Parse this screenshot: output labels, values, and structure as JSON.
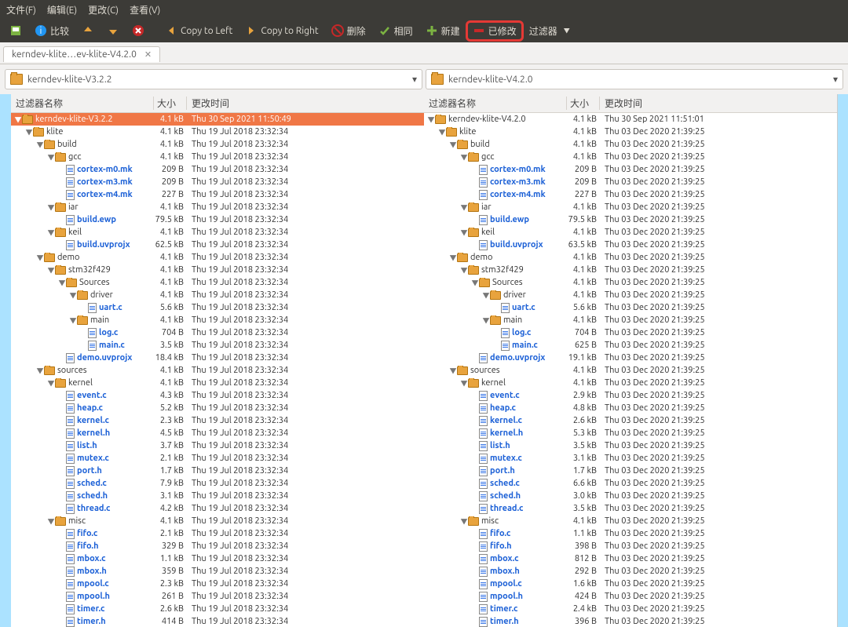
{
  "menu": {
    "file": "文件(F)",
    "edit": "编辑(E)",
    "changes": "更改(C)",
    "view": "查看(V)"
  },
  "toolbar": {
    "compare": "比较",
    "copy_left": "Copy to Left",
    "copy_right": "Copy to Right",
    "delete": "删除",
    "same": "相同",
    "new": "新建",
    "modified": "已修改",
    "filters": "过滤器"
  },
  "tab_title": "kerndev-klite…ev-klite-V4.2.0",
  "combo_left": "kerndev-klite-V3.2.2",
  "combo_right": "kerndev-klite-V4.2.0",
  "hdr": {
    "name": "过滤器名称",
    "size": "大小",
    "date": "更改时间"
  },
  "left": [
    {
      "d": 0,
      "t": "dir",
      "tw": "▼",
      "sel": true,
      "n": "kerndev-klite-V3.2.2",
      "s": "4.1 kB",
      "dt": "Thu 30 Sep 2021 11:50:49"
    },
    {
      "d": 1,
      "t": "dir",
      "tw": "▼",
      "n": "klite",
      "s": "4.1 kB",
      "dt": "Thu 19 Jul 2018 23:32:34"
    },
    {
      "d": 2,
      "t": "dir",
      "tw": "▼",
      "n": "build",
      "s": "4.1 kB",
      "dt": "Thu 19 Jul 2018 23:32:34"
    },
    {
      "d": 3,
      "t": "dir",
      "tw": "▼",
      "n": "gcc",
      "s": "4.1 kB",
      "dt": "Thu 19 Jul 2018 23:32:34"
    },
    {
      "d": 4,
      "t": "mod",
      "n": "cortex-m0.mk",
      "s": "209 B",
      "dt": "Thu 19 Jul 2018 23:32:34"
    },
    {
      "d": 4,
      "t": "mod",
      "n": "cortex-m3.mk",
      "s": "209 B",
      "dt": "Thu 19 Jul 2018 23:32:34"
    },
    {
      "d": 4,
      "t": "mod",
      "n": "cortex-m4.mk",
      "s": "227 B",
      "dt": "Thu 19 Jul 2018 23:32:34"
    },
    {
      "d": 3,
      "t": "dir",
      "tw": "▼",
      "n": "iar",
      "s": "4.1 kB",
      "dt": "Thu 19 Jul 2018 23:32:34"
    },
    {
      "d": 4,
      "t": "mod",
      "n": "build.ewp",
      "s": "79.5 kB",
      "dt": "Thu 19 Jul 2018 23:32:34"
    },
    {
      "d": 3,
      "t": "dir",
      "tw": "▼",
      "n": "keil",
      "s": "4.1 kB",
      "dt": "Thu 19 Jul 2018 23:32:34"
    },
    {
      "d": 4,
      "t": "mod",
      "n": "build.uvprojx",
      "s": "62.5 kB",
      "dt": "Thu 19 Jul 2018 23:32:34"
    },
    {
      "d": 2,
      "t": "dir",
      "tw": "▼",
      "n": "demo",
      "s": "4.1 kB",
      "dt": "Thu 19 Jul 2018 23:32:34"
    },
    {
      "d": 3,
      "t": "dir",
      "tw": "▼",
      "n": "stm32f429",
      "s": "4.1 kB",
      "dt": "Thu 19 Jul 2018 23:32:34"
    },
    {
      "d": 4,
      "t": "dir",
      "tw": "▼",
      "n": "Sources",
      "s": "4.1 kB",
      "dt": "Thu 19 Jul 2018 23:32:34"
    },
    {
      "d": 5,
      "t": "dir",
      "tw": "▼",
      "n": "driver",
      "s": "4.1 kB",
      "dt": "Thu 19 Jul 2018 23:32:34"
    },
    {
      "d": 6,
      "t": "mod",
      "n": "uart.c",
      "s": "5.6 kB",
      "dt": "Thu 19 Jul 2018 23:32:34"
    },
    {
      "d": 5,
      "t": "dir",
      "tw": "▼",
      "n": "main",
      "s": "4.1 kB",
      "dt": "Thu 19 Jul 2018 23:32:34"
    },
    {
      "d": 6,
      "t": "mod",
      "n": "log.c",
      "s": "704 B",
      "dt": "Thu 19 Jul 2018 23:32:34"
    },
    {
      "d": 6,
      "t": "mod",
      "n": "main.c",
      "s": "3.5 kB",
      "dt": "Thu 19 Jul 2018 23:32:34"
    },
    {
      "d": 4,
      "t": "mod",
      "n": "demo.uvprojx",
      "s": "18.4 kB",
      "dt": "Thu 19 Jul 2018 23:32:34"
    },
    {
      "d": 2,
      "t": "dir",
      "tw": "▼",
      "n": "sources",
      "s": "4.1 kB",
      "dt": "Thu 19 Jul 2018 23:32:34"
    },
    {
      "d": 3,
      "t": "dir",
      "tw": "▼",
      "n": "kernel",
      "s": "4.1 kB",
      "dt": "Thu 19 Jul 2018 23:32:34"
    },
    {
      "d": 4,
      "t": "mod",
      "n": "event.c",
      "s": "4.3 kB",
      "dt": "Thu 19 Jul 2018 23:32:34"
    },
    {
      "d": 4,
      "t": "mod",
      "n": "heap.c",
      "s": "5.2 kB",
      "dt": "Thu 19 Jul 2018 23:32:34"
    },
    {
      "d": 4,
      "t": "mod",
      "n": "kernel.c",
      "s": "2.3 kB",
      "dt": "Thu 19 Jul 2018 23:32:34"
    },
    {
      "d": 4,
      "t": "mod",
      "n": "kernel.h",
      "s": "4.5 kB",
      "dt": "Thu 19 Jul 2018 23:32:34"
    },
    {
      "d": 4,
      "t": "mod",
      "n": "list.h",
      "s": "3.7 kB",
      "dt": "Thu 19 Jul 2018 23:32:34"
    },
    {
      "d": 4,
      "t": "mod",
      "n": "mutex.c",
      "s": "2.1 kB",
      "dt": "Thu 19 Jul 2018 23:32:34"
    },
    {
      "d": 4,
      "t": "mod",
      "n": "port.h",
      "s": "1.7 kB",
      "dt": "Thu 19 Jul 2018 23:32:34"
    },
    {
      "d": 4,
      "t": "mod",
      "n": "sched.c",
      "s": "7.9 kB",
      "dt": "Thu 19 Jul 2018 23:32:34"
    },
    {
      "d": 4,
      "t": "mod",
      "n": "sched.h",
      "s": "3.1 kB",
      "dt": "Thu 19 Jul 2018 23:32:34"
    },
    {
      "d": 4,
      "t": "mod",
      "n": "thread.c",
      "s": "4.2 kB",
      "dt": "Thu 19 Jul 2018 23:32:34"
    },
    {
      "d": 3,
      "t": "dir",
      "tw": "▼",
      "n": "misc",
      "s": "4.1 kB",
      "dt": "Thu 19 Jul 2018 23:32:34"
    },
    {
      "d": 4,
      "t": "mod",
      "n": "fifo.c",
      "s": "2.1 kB",
      "dt": "Thu 19 Jul 2018 23:32:34"
    },
    {
      "d": 4,
      "t": "mod",
      "n": "fifo.h",
      "s": "329 B",
      "dt": "Thu 19 Jul 2018 23:32:34"
    },
    {
      "d": 4,
      "t": "mod",
      "n": "mbox.c",
      "s": "1.1 kB",
      "dt": "Thu 19 Jul 2018 23:32:34"
    },
    {
      "d": 4,
      "t": "mod",
      "n": "mbox.h",
      "s": "359 B",
      "dt": "Thu 19 Jul 2018 23:32:34"
    },
    {
      "d": 4,
      "t": "mod",
      "n": "mpool.c",
      "s": "2.3 kB",
      "dt": "Thu 19 Jul 2018 23:32:34"
    },
    {
      "d": 4,
      "t": "mod",
      "n": "mpool.h",
      "s": "261 B",
      "dt": "Thu 19 Jul 2018 23:32:34"
    },
    {
      "d": 4,
      "t": "mod",
      "n": "timer.c",
      "s": "2.6 kB",
      "dt": "Thu 19 Jul 2018 23:32:34"
    },
    {
      "d": 4,
      "t": "mod",
      "n": "timer.h",
      "s": "414 B",
      "dt": "Thu 19 Jul 2018 23:32:34"
    }
  ],
  "right": [
    {
      "d": 0,
      "t": "dir",
      "tw": "▼",
      "n": "kerndev-klite-V4.2.0",
      "s": "4.1 kB",
      "dt": "Thu 30 Sep 2021 11:51:01"
    },
    {
      "d": 1,
      "t": "dir",
      "tw": "▼",
      "n": "klite",
      "s": "4.1 kB",
      "dt": "Thu 03 Dec 2020 21:39:25"
    },
    {
      "d": 2,
      "t": "dir",
      "tw": "▼",
      "n": "build",
      "s": "4.1 kB",
      "dt": "Thu 03 Dec 2020 21:39:25"
    },
    {
      "d": 3,
      "t": "dir",
      "tw": "▼",
      "n": "gcc",
      "s": "4.1 kB",
      "dt": "Thu 03 Dec 2020 21:39:25"
    },
    {
      "d": 4,
      "t": "mod",
      "n": "cortex-m0.mk",
      "s": "209 B",
      "dt": "Thu 03 Dec 2020 21:39:25"
    },
    {
      "d": 4,
      "t": "mod",
      "n": "cortex-m3.mk",
      "s": "209 B",
      "dt": "Thu 03 Dec 2020 21:39:25"
    },
    {
      "d": 4,
      "t": "mod",
      "n": "cortex-m4.mk",
      "s": "227 B",
      "dt": "Thu 03 Dec 2020 21:39:25"
    },
    {
      "d": 3,
      "t": "dir",
      "tw": "▼",
      "n": "iar",
      "s": "4.1 kB",
      "dt": "Thu 03 Dec 2020 21:39:25"
    },
    {
      "d": 4,
      "t": "mod",
      "n": "build.ewp",
      "s": "79.5 kB",
      "dt": "Thu 03 Dec 2020 21:39:25"
    },
    {
      "d": 3,
      "t": "dir",
      "tw": "▼",
      "n": "keil",
      "s": "4.1 kB",
      "dt": "Thu 03 Dec 2020 21:39:25"
    },
    {
      "d": 4,
      "t": "mod",
      "n": "build.uvprojx",
      "s": "63.5 kB",
      "dt": "Thu 03 Dec 2020 21:39:25"
    },
    {
      "d": 2,
      "t": "dir",
      "tw": "▼",
      "n": "demo",
      "s": "4.1 kB",
      "dt": "Thu 03 Dec 2020 21:39:25"
    },
    {
      "d": 3,
      "t": "dir",
      "tw": "▼",
      "n": "stm32f429",
      "s": "4.1 kB",
      "dt": "Thu 03 Dec 2020 21:39:25"
    },
    {
      "d": 4,
      "t": "dir",
      "tw": "▼",
      "n": "Sources",
      "s": "4.1 kB",
      "dt": "Thu 03 Dec 2020 21:39:25"
    },
    {
      "d": 5,
      "t": "dir",
      "tw": "▼",
      "n": "driver",
      "s": "4.1 kB",
      "dt": "Thu 03 Dec 2020 21:39:25"
    },
    {
      "d": 6,
      "t": "mod",
      "n": "uart.c",
      "s": "5.6 kB",
      "dt": "Thu 03 Dec 2020 21:39:25"
    },
    {
      "d": 5,
      "t": "dir",
      "tw": "▼",
      "n": "main",
      "s": "4.1 kB",
      "dt": "Thu 03 Dec 2020 21:39:25"
    },
    {
      "d": 6,
      "t": "mod",
      "n": "log.c",
      "s": "704 B",
      "dt": "Thu 03 Dec 2020 21:39:25"
    },
    {
      "d": 6,
      "t": "mod",
      "n": "main.c",
      "s": "625 B",
      "dt": "Thu 03 Dec 2020 21:39:25"
    },
    {
      "d": 4,
      "t": "mod",
      "n": "demo.uvprojx",
      "s": "19.1 kB",
      "dt": "Thu 03 Dec 2020 21:39:25"
    },
    {
      "d": 2,
      "t": "dir",
      "tw": "▼",
      "n": "sources",
      "s": "4.1 kB",
      "dt": "Thu 03 Dec 2020 21:39:25"
    },
    {
      "d": 3,
      "t": "dir",
      "tw": "▼",
      "n": "kernel",
      "s": "4.1 kB",
      "dt": "Thu 03 Dec 2020 21:39:25"
    },
    {
      "d": 4,
      "t": "mod",
      "n": "event.c",
      "s": "2.9 kB",
      "dt": "Thu 03 Dec 2020 21:39:25"
    },
    {
      "d": 4,
      "t": "mod",
      "n": "heap.c",
      "s": "4.8 kB",
      "dt": "Thu 03 Dec 2020 21:39:25"
    },
    {
      "d": 4,
      "t": "mod",
      "n": "kernel.c",
      "s": "2.6 kB",
      "dt": "Thu 03 Dec 2020 21:39:25"
    },
    {
      "d": 4,
      "t": "mod",
      "n": "kernel.h",
      "s": "5.3 kB",
      "dt": "Thu 03 Dec 2020 21:39:25"
    },
    {
      "d": 4,
      "t": "mod",
      "n": "list.h",
      "s": "3.5 kB",
      "dt": "Thu 03 Dec 2020 21:39:25"
    },
    {
      "d": 4,
      "t": "mod",
      "n": "mutex.c",
      "s": "3.1 kB",
      "dt": "Thu 03 Dec 2020 21:39:25"
    },
    {
      "d": 4,
      "t": "mod",
      "n": "port.h",
      "s": "1.7 kB",
      "dt": "Thu 03 Dec 2020 21:39:25"
    },
    {
      "d": 4,
      "t": "mod",
      "n": "sched.c",
      "s": "6.6 kB",
      "dt": "Thu 03 Dec 2020 21:39:25"
    },
    {
      "d": 4,
      "t": "mod",
      "n": "sched.h",
      "s": "3.0 kB",
      "dt": "Thu 03 Dec 2020 21:39:25"
    },
    {
      "d": 4,
      "t": "mod",
      "n": "thread.c",
      "s": "3.5 kB",
      "dt": "Thu 03 Dec 2020 21:39:25"
    },
    {
      "d": 3,
      "t": "dir",
      "tw": "▼",
      "n": "misc",
      "s": "4.1 kB",
      "dt": "Thu 03 Dec 2020 21:39:25"
    },
    {
      "d": 4,
      "t": "mod",
      "n": "fifo.c",
      "s": "1.1 kB",
      "dt": "Thu 03 Dec 2020 21:39:25"
    },
    {
      "d": 4,
      "t": "mod",
      "n": "fifo.h",
      "s": "398 B",
      "dt": "Thu 03 Dec 2020 21:39:25"
    },
    {
      "d": 4,
      "t": "mod",
      "n": "mbox.c",
      "s": "812 B",
      "dt": "Thu 03 Dec 2020 21:39:25"
    },
    {
      "d": 4,
      "t": "mod",
      "n": "mbox.h",
      "s": "292 B",
      "dt": "Thu 03 Dec 2020 21:39:25"
    },
    {
      "d": 4,
      "t": "mod",
      "n": "mpool.c",
      "s": "1.6 kB",
      "dt": "Thu 03 Dec 2020 21:39:25"
    },
    {
      "d": 4,
      "t": "mod",
      "n": "mpool.h",
      "s": "424 B",
      "dt": "Thu 03 Dec 2020 21:39:25"
    },
    {
      "d": 4,
      "t": "mod",
      "n": "timer.c",
      "s": "2.4 kB",
      "dt": "Thu 03 Dec 2020 21:39:25"
    },
    {
      "d": 4,
      "t": "mod",
      "n": "timer.h",
      "s": "396 B",
      "dt": "Thu 03 Dec 2020 21:39:25"
    }
  ]
}
